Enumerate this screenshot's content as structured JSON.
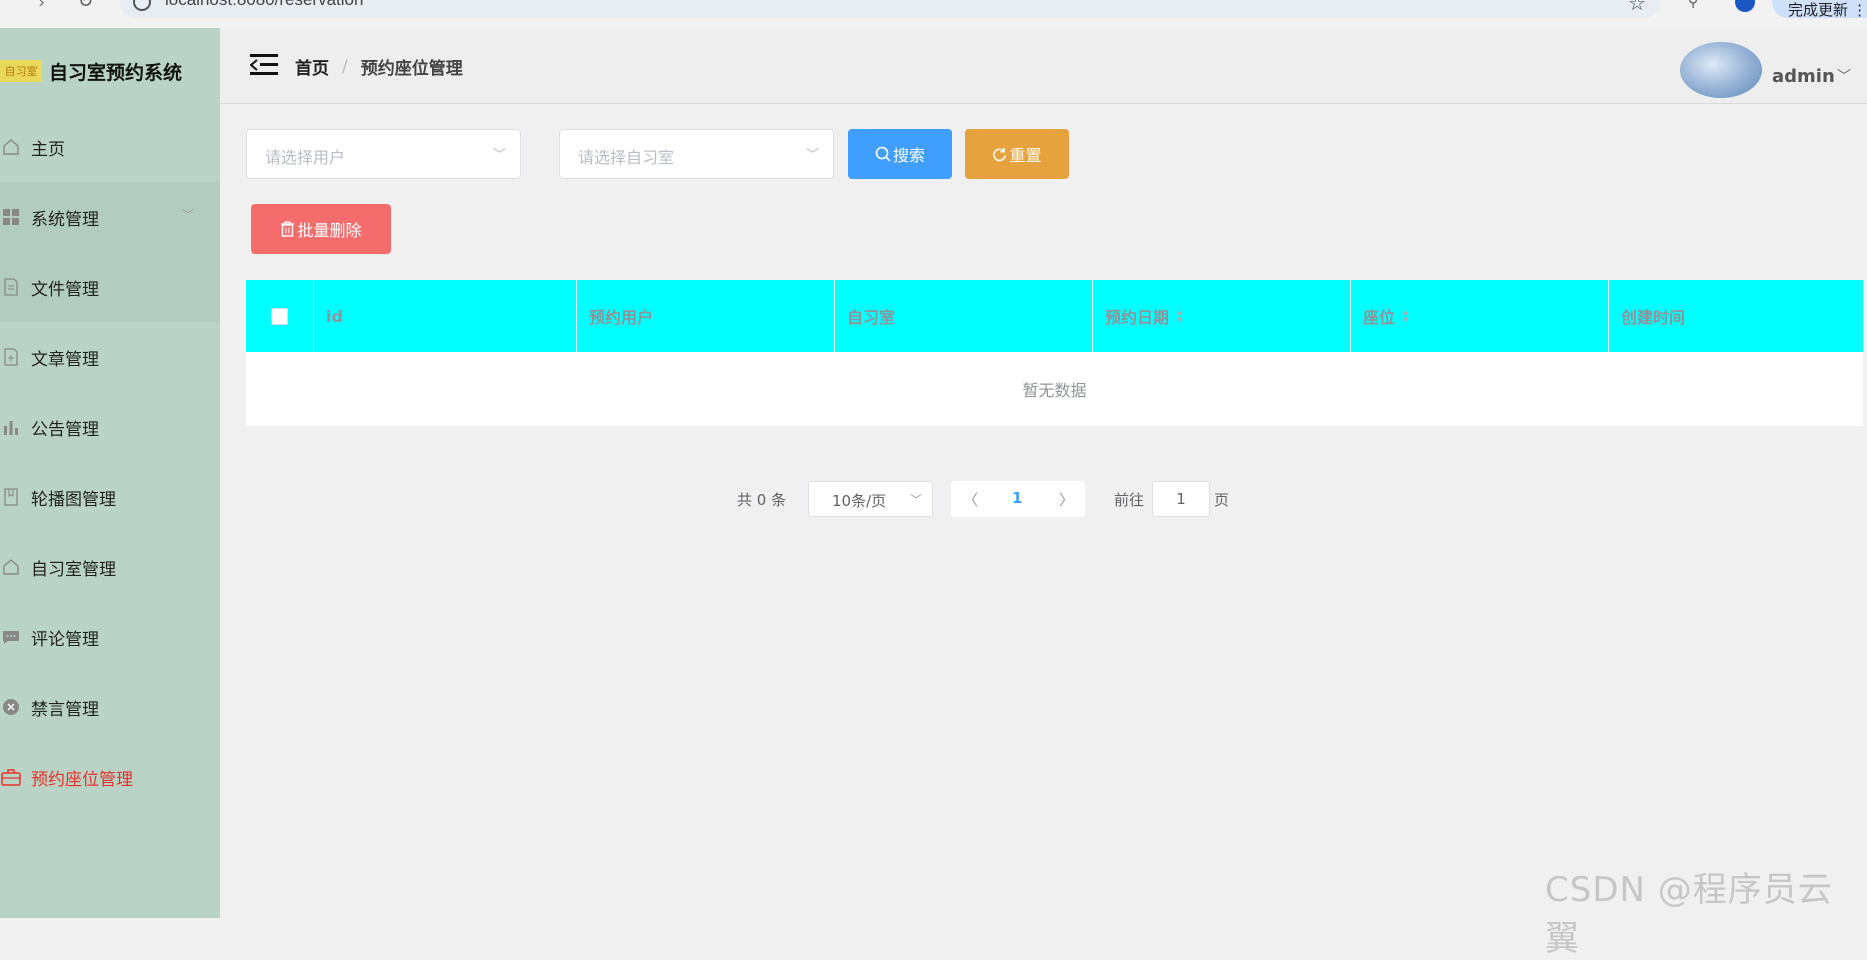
{
  "browser": {
    "url": "localhost:8080/reservation",
    "update_label": "完成更新 ⋮"
  },
  "sidebar": {
    "logo_text": "自习室",
    "title": "自习室预约系统",
    "items": [
      {
        "label": "主页",
        "icon": "home-icon"
      },
      {
        "label": "系统管理",
        "icon": "grid-icon",
        "has_submenu": true
      },
      {
        "label": "文件管理",
        "icon": "document-icon"
      },
      {
        "label": "文章管理",
        "icon": "document-add-icon"
      },
      {
        "label": "公告管理",
        "icon": "bar-chart-icon"
      },
      {
        "label": "轮播图管理",
        "icon": "notebook-icon"
      },
      {
        "label": "自习室管理",
        "icon": "house-icon"
      },
      {
        "label": "评论管理",
        "icon": "chat-icon"
      },
      {
        "label": "禁言管理",
        "icon": "circle-close-icon"
      },
      {
        "label": "预约座位管理",
        "icon": "briefcase-icon",
        "active": true
      }
    ]
  },
  "header": {
    "breadcrumb_home": "首页",
    "breadcrumb_separator": "/",
    "breadcrumb_current": "预约座位管理",
    "username": "admin"
  },
  "filters": {
    "user_placeholder": "请选择用户",
    "room_placeholder": "请选择自习室",
    "search_label": "搜索",
    "reset_label": "重置",
    "batch_delete_label": "批量删除"
  },
  "table": {
    "columns": [
      "id",
      "预约用户",
      "自习室",
      "预约日期",
      "座位",
      "创建时间"
    ],
    "empty_text": "暂无数据"
  },
  "pagination": {
    "total_text": "共 0 条",
    "page_size": "10条/页",
    "current_page": "1",
    "goto_label": "前往",
    "goto_value": "1",
    "page_unit": "页"
  },
  "watermark": "CSDN @程序员云翼",
  "colors": {
    "sidebar_bg": "#b9d4c6",
    "table_header_bg": "#00ffff",
    "primary": "#409eff",
    "warning": "#e6a23c",
    "danger": "#f56c6c",
    "active_menu": "#e8312b"
  }
}
